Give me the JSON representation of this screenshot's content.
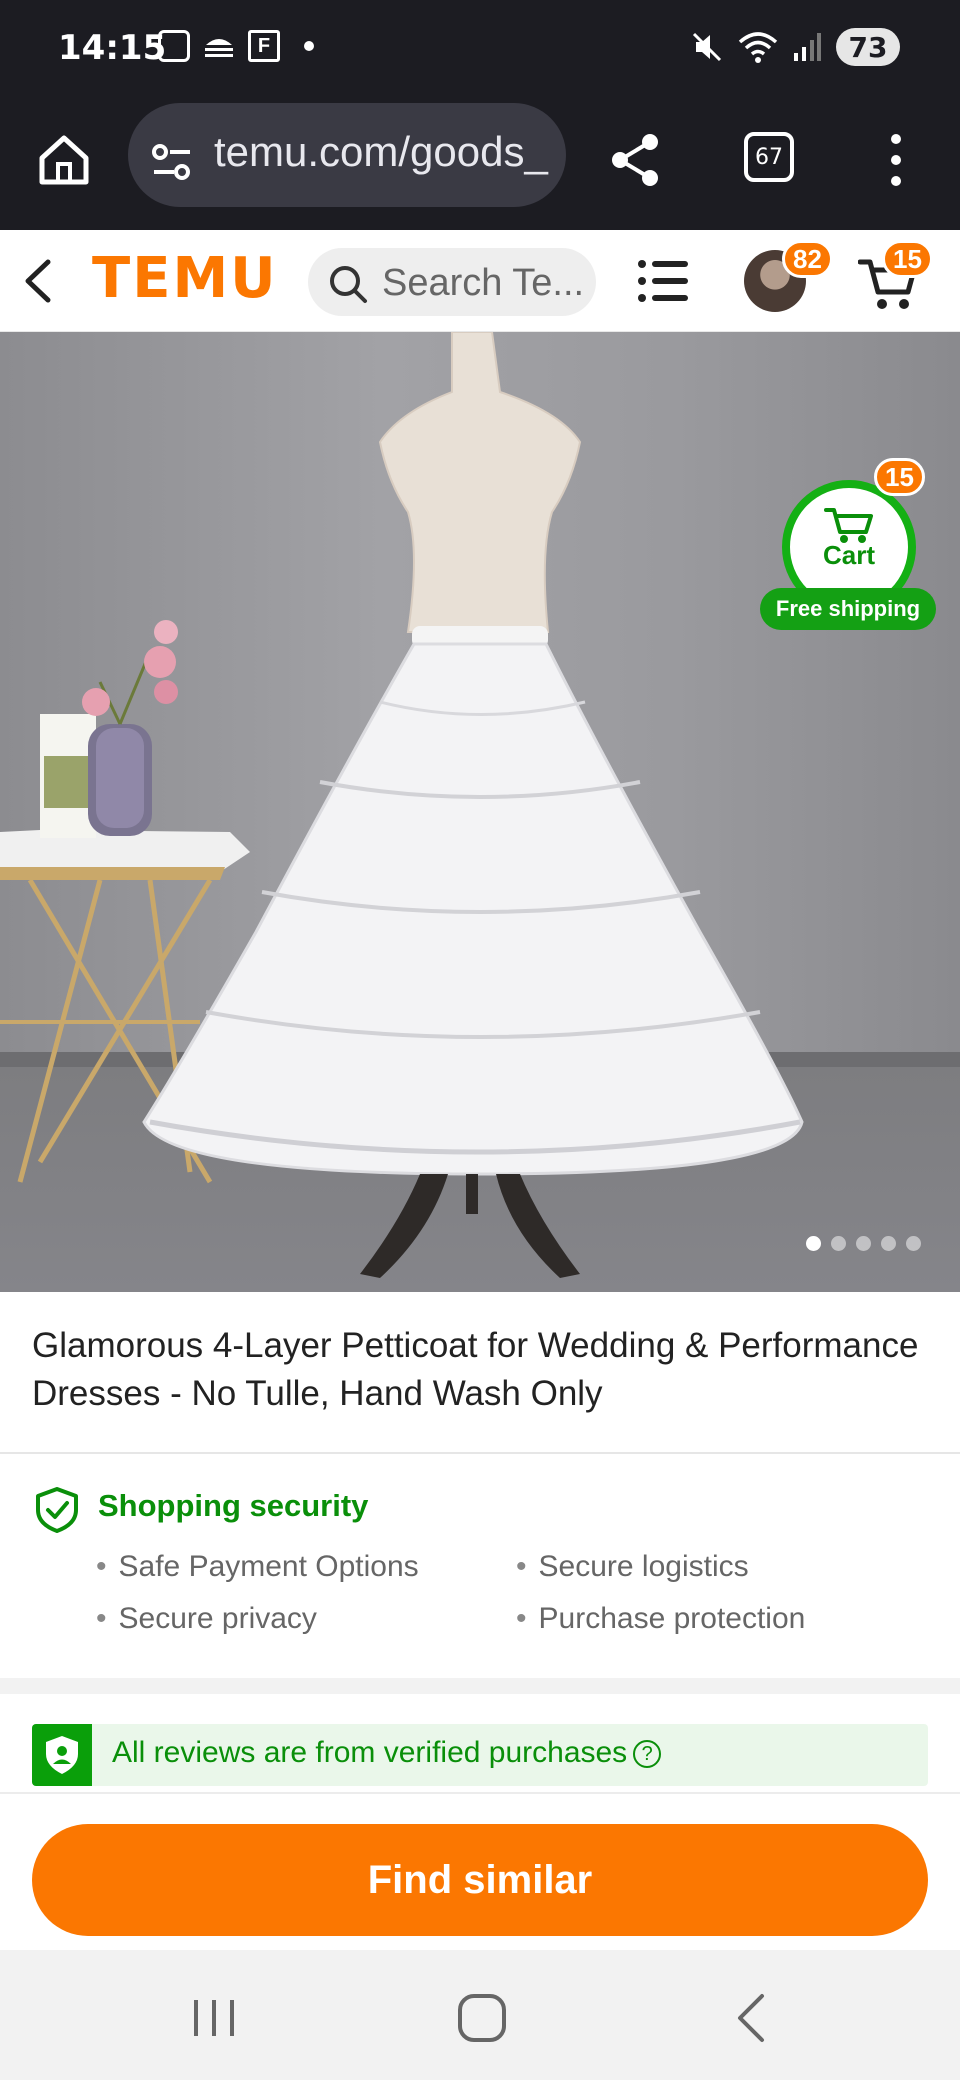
{
  "status_bar": {
    "time": "14:15",
    "battery": "73",
    "icons": [
      "screenshot-icon",
      "weather-icon",
      "app-f-icon",
      "mute-icon",
      "wifi-icon",
      "signal-icon"
    ]
  },
  "browser": {
    "url": "temu.com/goods_",
    "tab_count": "67"
  },
  "site_header": {
    "logo": "TEMU",
    "search_placeholder": "Search Te...",
    "avatar_badge": "82",
    "cart_badge": "15"
  },
  "product": {
    "floating_cart": {
      "label": "Cart",
      "badge": "15",
      "free_shipping": "Free shipping"
    },
    "image_count": 5,
    "active_image": 1,
    "title": "Glamorous 4-Layer Petticoat for Wedding & Performance Dresses - No Tulle, Hand Wash Only"
  },
  "security": {
    "title": "Shopping security",
    "items": [
      "Safe Payment Options",
      "Secure logistics",
      "Secure privacy",
      "Purchase protection"
    ]
  },
  "reviews": {
    "verified_text": "All reviews are from verified purchases",
    "help_glyph": "?"
  },
  "actions": {
    "find_similar": "Find similar"
  },
  "colors": {
    "brand": "#fb7701",
    "success": "#0a8f0a",
    "dark_bar": "#1c1c22"
  }
}
